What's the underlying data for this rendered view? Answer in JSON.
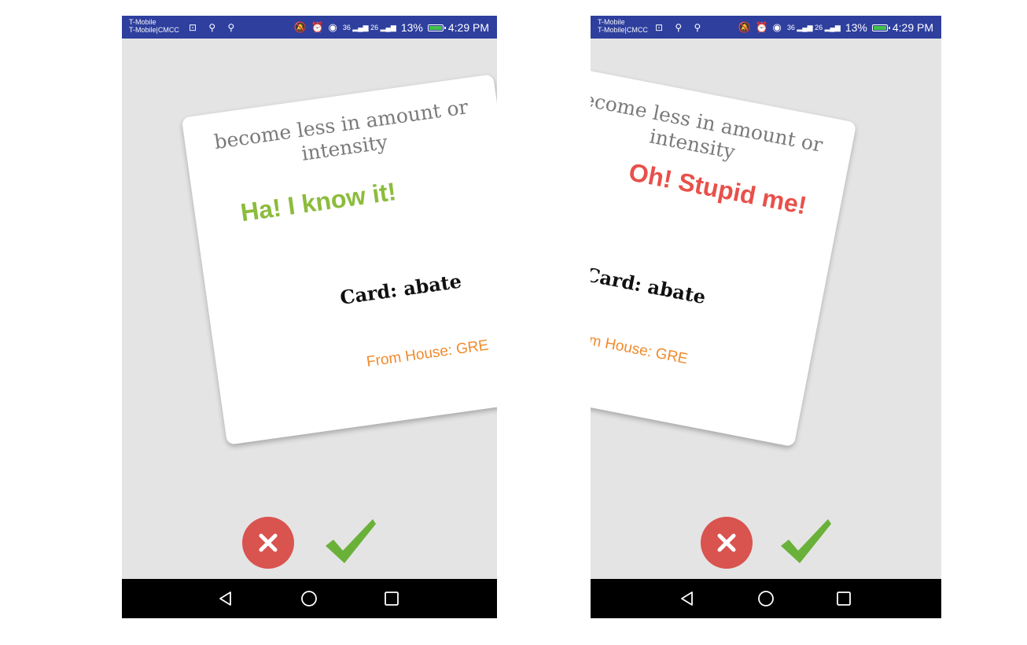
{
  "screens": [
    {
      "status": {
        "carrier_line1": "T-Mobile",
        "carrier_line2": "T-Mobile|CMCC",
        "usb_icons": "⊡ ⚲ ⚲",
        "sys_icons": "🔕 ⏰ ◉",
        "signal": "36 ▂▄▆ 26 ▂▄▆",
        "battery": "13%",
        "time": "4:29 PM"
      },
      "card": {
        "definition": "become less in amount or intensity",
        "feedback": "Ha! I know it!",
        "feedback_color": "#8cbc3c",
        "word": "Card: abate",
        "source": "From House: GRE",
        "source_color": "#f08a2c"
      }
    },
    {
      "status": {
        "carrier_line1": "T-Mobile",
        "carrier_line2": "T-Mobile|CMCC",
        "usb_icons": "⊡ ⚲ ⚲",
        "sys_icons": "🔕 ⏰ ◉",
        "signal": "36 ▂▄▆ 26 ▂▄▆",
        "battery": "13%",
        "time": "4:29 PM"
      },
      "card": {
        "definition": "become less in amount or intensity",
        "feedback": "Oh! Stupid me!",
        "feedback_color": "#e8504a",
        "word": "Card: abate",
        "source": "From House: GRE",
        "source_color": "#f08a2c"
      }
    }
  ],
  "actions": {
    "reject_icon": "close-icon",
    "reject_color": "#d9534f",
    "accept_icon": "checkmark-icon",
    "accept_color": "#6ab13a"
  },
  "nav": {
    "back_icon": "back-triangle-icon",
    "home_icon": "home-circle-icon",
    "recents_icon": "recents-square-icon"
  },
  "colors": {
    "status_bar": "#2e3f9e",
    "background": "#e4e4e4",
    "nav_bar": "#000000"
  }
}
